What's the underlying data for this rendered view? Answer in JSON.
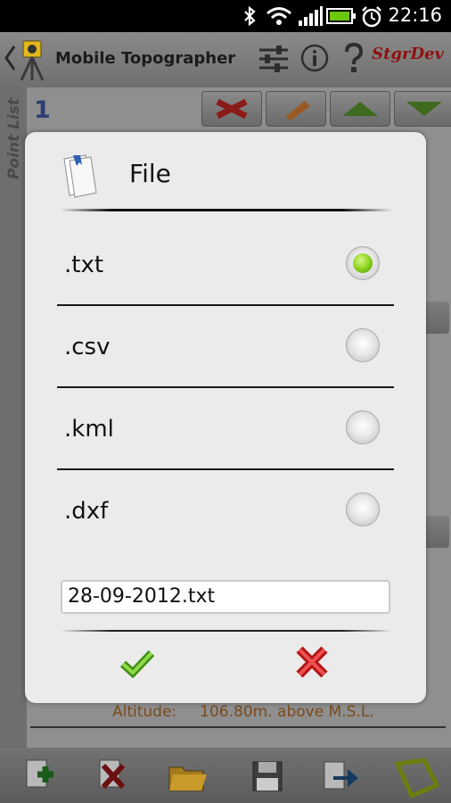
{
  "status_bar": {
    "time": "22:16",
    "icons": [
      "bluetooth-icon",
      "wifi-icon",
      "signal-icon",
      "battery-icon",
      "alarm-icon"
    ]
  },
  "action_bar": {
    "title": "Mobile Topographer",
    "brand": "StgrDev",
    "actions": [
      "settings-sliders-icon",
      "info-icon",
      "help-icon"
    ]
  },
  "side_tab": {
    "label": "Point List"
  },
  "background": {
    "point_number": "1",
    "toolbar_icons": [
      "delete-icon",
      "edit-icon",
      "move-up-icon",
      "move-down-icon"
    ],
    "altitude_label": "Altitude:",
    "altitude_value": "106.80m. above M.S.L."
  },
  "bottom_bar": {
    "icons": [
      "add-point-icon",
      "delete-point-icon",
      "open-folder-icon",
      "save-icon",
      "export-icon",
      "polygon-icon"
    ]
  },
  "dialog": {
    "title": "File",
    "options": [
      {
        "label": ".txt",
        "selected": true
      },
      {
        "label": ".csv",
        "selected": false
      },
      {
        "label": ".kml",
        "selected": false
      },
      {
        "label": ".dxf",
        "selected": false
      }
    ],
    "filename": "28-09-2012.txt",
    "ok_icon": "checkmark-icon",
    "cancel_icon": "cancel-x-icon"
  },
  "colors": {
    "radio_selected": "#8cd31e",
    "brand": "#8e1010",
    "altitude_text": "#7a4a1c",
    "point_number": "#2c3f73"
  }
}
